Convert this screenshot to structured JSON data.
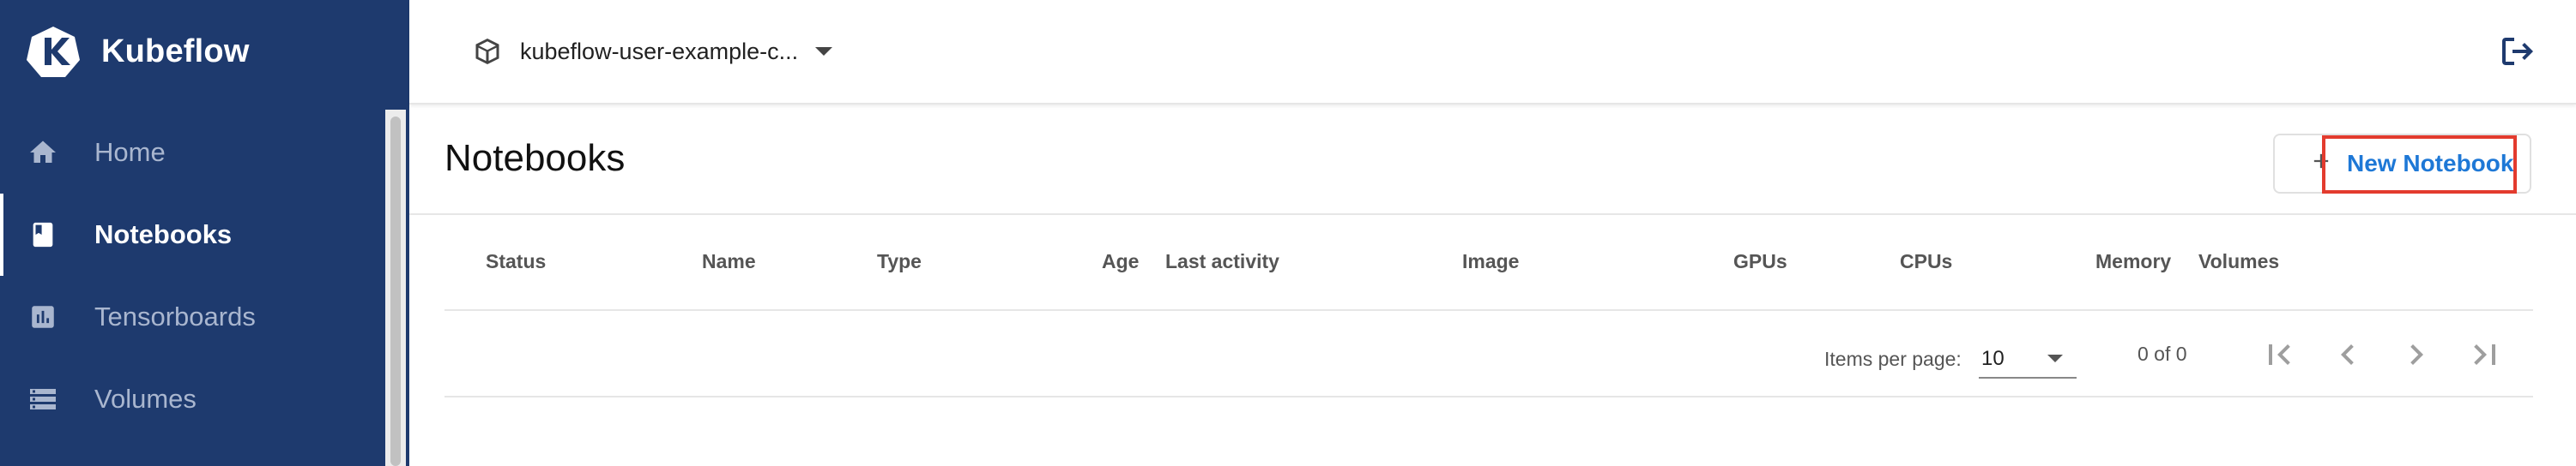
{
  "app": {
    "name": "Kubeflow"
  },
  "sidebar": {
    "items": [
      {
        "label": "Home",
        "icon": "home-icon",
        "active": false
      },
      {
        "label": "Notebooks",
        "icon": "book-icon",
        "active": true
      },
      {
        "label": "Tensorboards",
        "icon": "bar-chart-icon",
        "active": false
      },
      {
        "label": "Volumes",
        "icon": "storage-icon",
        "active": false
      }
    ]
  },
  "header": {
    "namespace": "kubeflow-user-example-c...",
    "namespace_icon": "cube-icon",
    "logout_icon": "logout-icon"
  },
  "main": {
    "title": "Notebooks",
    "new_button_label": "New Notebook",
    "columns": [
      "Status",
      "Name",
      "Type",
      "Age",
      "Last activity",
      "Image",
      "GPUs",
      "CPUs",
      "Memory",
      "Volumes"
    ]
  },
  "pagination": {
    "items_per_page_label": "Items per page:",
    "items_per_page_value": "10",
    "range_label": "0 of 0"
  },
  "colors": {
    "sidebar_bg": "#1e3a6e",
    "accent": "#1e78d6",
    "highlight": "#e33b2e"
  }
}
